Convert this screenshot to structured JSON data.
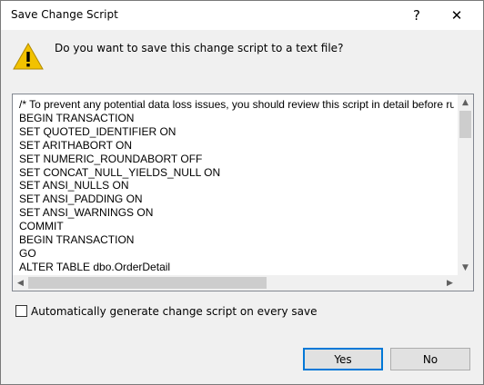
{
  "window": {
    "title": "Save Change Script",
    "help_label": "?",
    "close_label": "✕"
  },
  "icons": {
    "warning": "warning-icon",
    "accent": "#f2c200"
  },
  "message": "Do you want to save this change script to a text file?",
  "script": {
    "lines": [
      "/* To prevent any potential data loss issues, you should review this script in detail before ru",
      "BEGIN TRANSACTION",
      "SET QUOTED_IDENTIFIER ON",
      "SET ARITHABORT ON",
      "SET NUMERIC_ROUNDABORT OFF",
      "SET CONCAT_NULL_YIELDS_NULL ON",
      "SET ANSI_NULLS ON",
      "SET ANSI_PADDING ON",
      "SET ANSI_WARNINGS ON",
      "COMMIT",
      "BEGIN TRANSACTION",
      "GO",
      "ALTER TABLE dbo.OrderDetail"
    ]
  },
  "auto_generate": {
    "label": "Automatically generate change script on every save",
    "checked": false
  },
  "buttons": {
    "yes": "Yes",
    "no": "No"
  }
}
